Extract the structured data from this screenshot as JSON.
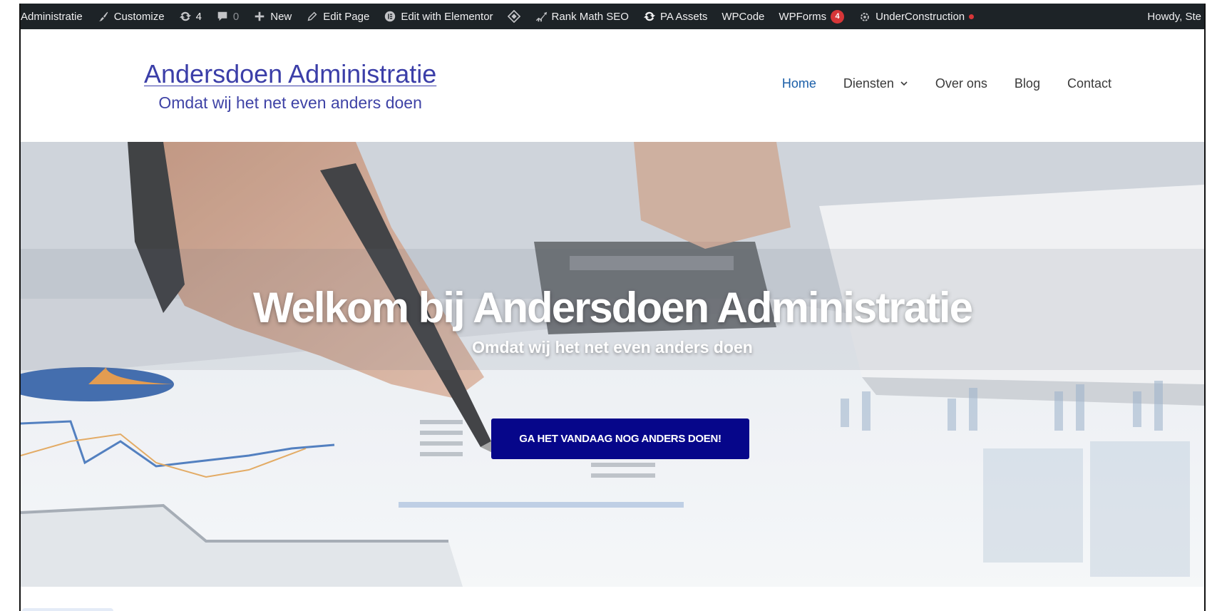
{
  "admin_bar": {
    "site_name": "Administratie",
    "customize": "Customize",
    "updates_count": "4",
    "comments_count": "0",
    "new": "New",
    "edit_page": "Edit Page",
    "edit_with_elementor": "Edit with Elementor",
    "rank_math": "Rank Math SEO",
    "pa_assets": "PA Assets",
    "wpcode": "WPCode",
    "wpforms": "WPForms",
    "wpforms_badge": "4",
    "under_construction": "UnderConstruction",
    "howdy": "Howdy, Ste"
  },
  "header": {
    "brand_title": "Andersdoen Administratie",
    "brand_tagline": "Omdat wij het net even anders doen",
    "nav": {
      "home": "Home",
      "diensten": "Diensten",
      "over_ons": "Over ons",
      "blog": "Blog",
      "contact": "Contact"
    }
  },
  "hero": {
    "title": "Welkom bij Andersdoen Administratie",
    "subtitle": "Omdat wij het net even anders doen",
    "cta": "GA HET VANDAAG NOG ANDERS DOEN!"
  },
  "colors": {
    "admin_bar_bg": "#1d2327",
    "brand": "#3b3ea8",
    "nav_active": "#1a5ea8",
    "cta_bg": "#06068a",
    "badge_red": "#d63638"
  }
}
